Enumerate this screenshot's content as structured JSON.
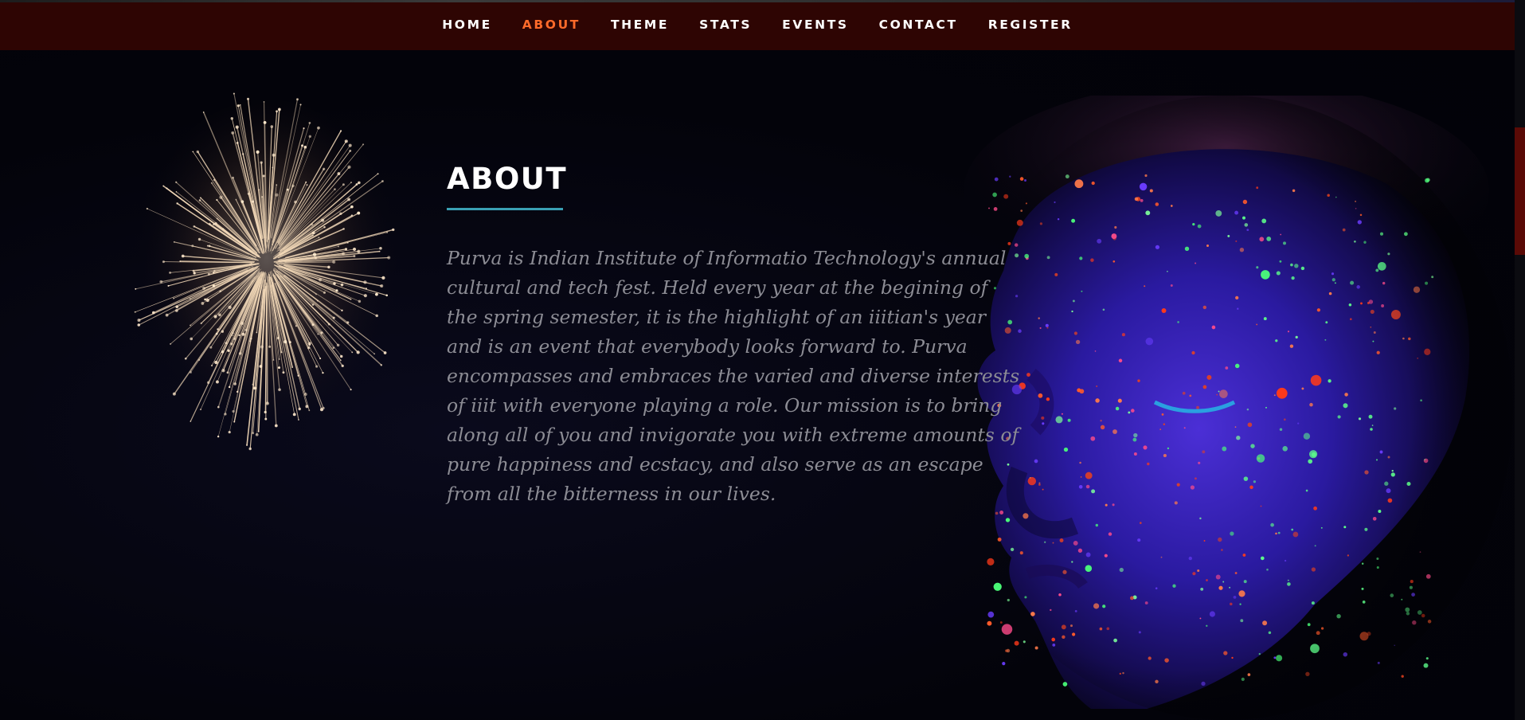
{
  "nav": {
    "items": [
      {
        "label": "HOME",
        "active": false
      },
      {
        "label": "ABOUT",
        "active": true
      },
      {
        "label": "THEME",
        "active": false
      },
      {
        "label": "STATS",
        "active": false
      },
      {
        "label": "EVENTS",
        "active": false
      },
      {
        "label": "CONTACT",
        "active": false
      },
      {
        "label": "REGISTER",
        "active": false
      }
    ],
    "background": "#2e0503",
    "active_color": "#ff6a2a"
  },
  "about": {
    "title": "ABOUT",
    "underline_color": "#3aa0b4",
    "body": "Purva is Indian Institute of Informatio Technology's annual cultural and tech fest. Held every year at the begining of the spring semester, it is the highlight of an iiitian's year and is an event that everybody looks forward to. Purva encompasses and embraces the varied and diverse interests of iiit with everyone playing a role. Our mission is to bring along all of you and invigorate you with extreme amounts of pure happiness and ecstacy, and also serve as an escape from all the bitterness in our lives."
  },
  "images": {
    "firework": "firework-image",
    "face": "neon-paint-face-image"
  }
}
